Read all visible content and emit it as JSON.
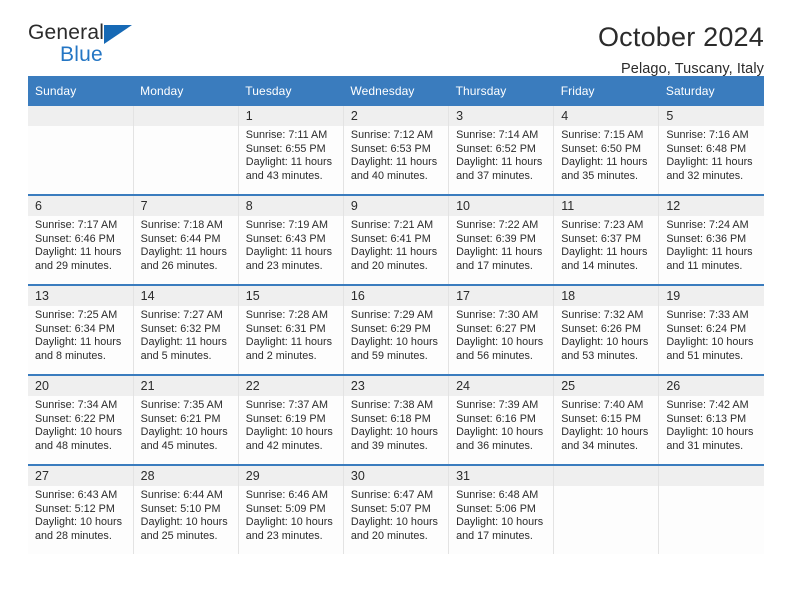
{
  "brand": {
    "name_top": "General",
    "name_bottom": "Blue",
    "triangle_color": "#1669b5",
    "blue_text_color": "#2476c4"
  },
  "header": {
    "title": "October 2024",
    "subtitle": "Pelago, Tuscany, Italy"
  },
  "theme": {
    "header_blue": "#3a7cbe",
    "date_band_gray": "#efefef",
    "cell_background": "#fdfdfd"
  },
  "calendar": {
    "weekday_headers": [
      "Sunday",
      "Monday",
      "Tuesday",
      "Wednesday",
      "Thursday",
      "Friday",
      "Saturday"
    ],
    "labels": {
      "sunrise": "Sunrise:",
      "sunset": "Sunset:",
      "daylight": "Daylight:"
    },
    "weeks": [
      [
        {
          "date": "",
          "empty": true
        },
        {
          "date": "",
          "empty": true
        },
        {
          "date": "1",
          "sunrise": "Sunrise: 7:11 AM",
          "sunset": "Sunset: 6:55 PM",
          "daylight_l1": "Daylight: 11 hours",
          "daylight_l2": "and 43 minutes."
        },
        {
          "date": "2",
          "sunrise": "Sunrise: 7:12 AM",
          "sunset": "Sunset: 6:53 PM",
          "daylight_l1": "Daylight: 11 hours",
          "daylight_l2": "and 40 minutes."
        },
        {
          "date": "3",
          "sunrise": "Sunrise: 7:14 AM",
          "sunset": "Sunset: 6:52 PM",
          "daylight_l1": "Daylight: 11 hours",
          "daylight_l2": "and 37 minutes."
        },
        {
          "date": "4",
          "sunrise": "Sunrise: 7:15 AM",
          "sunset": "Sunset: 6:50 PM",
          "daylight_l1": "Daylight: 11 hours",
          "daylight_l2": "and 35 minutes."
        },
        {
          "date": "5",
          "sunrise": "Sunrise: 7:16 AM",
          "sunset": "Sunset: 6:48 PM",
          "daylight_l1": "Daylight: 11 hours",
          "daylight_l2": "and 32 minutes."
        }
      ],
      [
        {
          "date": "6",
          "sunrise": "Sunrise: 7:17 AM",
          "sunset": "Sunset: 6:46 PM",
          "daylight_l1": "Daylight: 11 hours",
          "daylight_l2": "and 29 minutes."
        },
        {
          "date": "7",
          "sunrise": "Sunrise: 7:18 AM",
          "sunset": "Sunset: 6:44 PM",
          "daylight_l1": "Daylight: 11 hours",
          "daylight_l2": "and 26 minutes."
        },
        {
          "date": "8",
          "sunrise": "Sunrise: 7:19 AM",
          "sunset": "Sunset: 6:43 PM",
          "daylight_l1": "Daylight: 11 hours",
          "daylight_l2": "and 23 minutes."
        },
        {
          "date": "9",
          "sunrise": "Sunrise: 7:21 AM",
          "sunset": "Sunset: 6:41 PM",
          "daylight_l1": "Daylight: 11 hours",
          "daylight_l2": "and 20 minutes."
        },
        {
          "date": "10",
          "sunrise": "Sunrise: 7:22 AM",
          "sunset": "Sunset: 6:39 PM",
          "daylight_l1": "Daylight: 11 hours",
          "daylight_l2": "and 17 minutes."
        },
        {
          "date": "11",
          "sunrise": "Sunrise: 7:23 AM",
          "sunset": "Sunset: 6:37 PM",
          "daylight_l1": "Daylight: 11 hours",
          "daylight_l2": "and 14 minutes."
        },
        {
          "date": "12",
          "sunrise": "Sunrise: 7:24 AM",
          "sunset": "Sunset: 6:36 PM",
          "daylight_l1": "Daylight: 11 hours",
          "daylight_l2": "and 11 minutes."
        }
      ],
      [
        {
          "date": "13",
          "sunrise": "Sunrise: 7:25 AM",
          "sunset": "Sunset: 6:34 PM",
          "daylight_l1": "Daylight: 11 hours",
          "daylight_l2": "and 8 minutes."
        },
        {
          "date": "14",
          "sunrise": "Sunrise: 7:27 AM",
          "sunset": "Sunset: 6:32 PM",
          "daylight_l1": "Daylight: 11 hours",
          "daylight_l2": "and 5 minutes."
        },
        {
          "date": "15",
          "sunrise": "Sunrise: 7:28 AM",
          "sunset": "Sunset: 6:31 PM",
          "daylight_l1": "Daylight: 11 hours",
          "daylight_l2": "and 2 minutes."
        },
        {
          "date": "16",
          "sunrise": "Sunrise: 7:29 AM",
          "sunset": "Sunset: 6:29 PM",
          "daylight_l1": "Daylight: 10 hours",
          "daylight_l2": "and 59 minutes."
        },
        {
          "date": "17",
          "sunrise": "Sunrise: 7:30 AM",
          "sunset": "Sunset: 6:27 PM",
          "daylight_l1": "Daylight: 10 hours",
          "daylight_l2": "and 56 minutes."
        },
        {
          "date": "18",
          "sunrise": "Sunrise: 7:32 AM",
          "sunset": "Sunset: 6:26 PM",
          "daylight_l1": "Daylight: 10 hours",
          "daylight_l2": "and 53 minutes."
        },
        {
          "date": "19",
          "sunrise": "Sunrise: 7:33 AM",
          "sunset": "Sunset: 6:24 PM",
          "daylight_l1": "Daylight: 10 hours",
          "daylight_l2": "and 51 minutes."
        }
      ],
      [
        {
          "date": "20",
          "sunrise": "Sunrise: 7:34 AM",
          "sunset": "Sunset: 6:22 PM",
          "daylight_l1": "Daylight: 10 hours",
          "daylight_l2": "and 48 minutes."
        },
        {
          "date": "21",
          "sunrise": "Sunrise: 7:35 AM",
          "sunset": "Sunset: 6:21 PM",
          "daylight_l1": "Daylight: 10 hours",
          "daylight_l2": "and 45 minutes."
        },
        {
          "date": "22",
          "sunrise": "Sunrise: 7:37 AM",
          "sunset": "Sunset: 6:19 PM",
          "daylight_l1": "Daylight: 10 hours",
          "daylight_l2": "and 42 minutes."
        },
        {
          "date": "23",
          "sunrise": "Sunrise: 7:38 AM",
          "sunset": "Sunset: 6:18 PM",
          "daylight_l1": "Daylight: 10 hours",
          "daylight_l2": "and 39 minutes."
        },
        {
          "date": "24",
          "sunrise": "Sunrise: 7:39 AM",
          "sunset": "Sunset: 6:16 PM",
          "daylight_l1": "Daylight: 10 hours",
          "daylight_l2": "and 36 minutes."
        },
        {
          "date": "25",
          "sunrise": "Sunrise: 7:40 AM",
          "sunset": "Sunset: 6:15 PM",
          "daylight_l1": "Daylight: 10 hours",
          "daylight_l2": "and 34 minutes."
        },
        {
          "date": "26",
          "sunrise": "Sunrise: 7:42 AM",
          "sunset": "Sunset: 6:13 PM",
          "daylight_l1": "Daylight: 10 hours",
          "daylight_l2": "and 31 minutes."
        }
      ],
      [
        {
          "date": "27",
          "sunrise": "Sunrise: 6:43 AM",
          "sunset": "Sunset: 5:12 PM",
          "daylight_l1": "Daylight: 10 hours",
          "daylight_l2": "and 28 minutes."
        },
        {
          "date": "28",
          "sunrise": "Sunrise: 6:44 AM",
          "sunset": "Sunset: 5:10 PM",
          "daylight_l1": "Daylight: 10 hours",
          "daylight_l2": "and 25 minutes."
        },
        {
          "date": "29",
          "sunrise": "Sunrise: 6:46 AM",
          "sunset": "Sunset: 5:09 PM",
          "daylight_l1": "Daylight: 10 hours",
          "daylight_l2": "and 23 minutes."
        },
        {
          "date": "30",
          "sunrise": "Sunrise: 6:47 AM",
          "sunset": "Sunset: 5:07 PM",
          "daylight_l1": "Daylight: 10 hours",
          "daylight_l2": "and 20 minutes."
        },
        {
          "date": "31",
          "sunrise": "Sunrise: 6:48 AM",
          "sunset": "Sunset: 5:06 PM",
          "daylight_l1": "Daylight: 10 hours",
          "daylight_l2": "and 17 minutes."
        },
        {
          "date": "",
          "empty": true
        },
        {
          "date": "",
          "empty": true
        }
      ]
    ]
  }
}
